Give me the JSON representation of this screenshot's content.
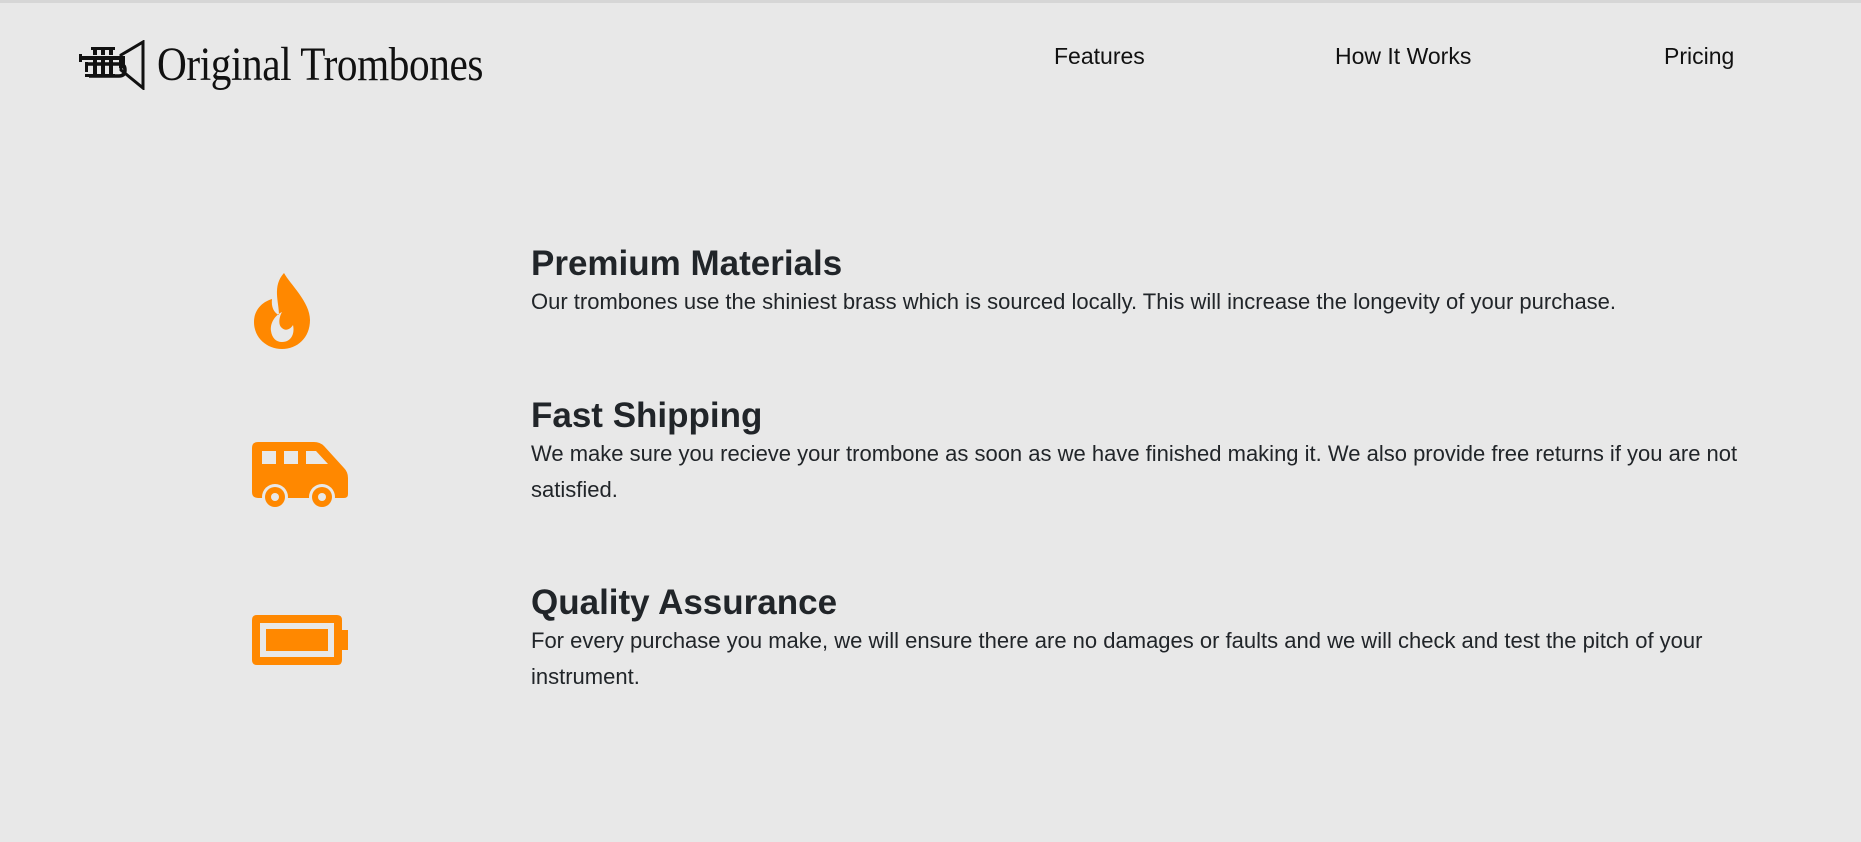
{
  "header": {
    "logo_icon": "trumpet-icon",
    "logo_text": "Original Trombones",
    "nav": [
      {
        "label": "Features"
      },
      {
        "label": "How It Works"
      },
      {
        "label": "Pricing"
      }
    ]
  },
  "features": [
    {
      "icon": "fire-icon",
      "title": "Premium Materials",
      "description": "Our trombones use the shiniest brass which is sourced locally. This will increase the longevity of your purchase."
    },
    {
      "icon": "van-icon",
      "title": "Fast Shipping",
      "description": "We make sure you recieve your trombone as soon as we have finished making it. We also provide free returns if you are not satisfied."
    },
    {
      "icon": "battery-full-icon",
      "title": "Quality Assurance",
      "description": "For every purchase you make, we will ensure there are no damages or faults and we will check and test the pitch of your instrument."
    }
  ],
  "colors": {
    "background": "#e8e8e8",
    "accent": "#ff8800",
    "text": "#212529"
  }
}
